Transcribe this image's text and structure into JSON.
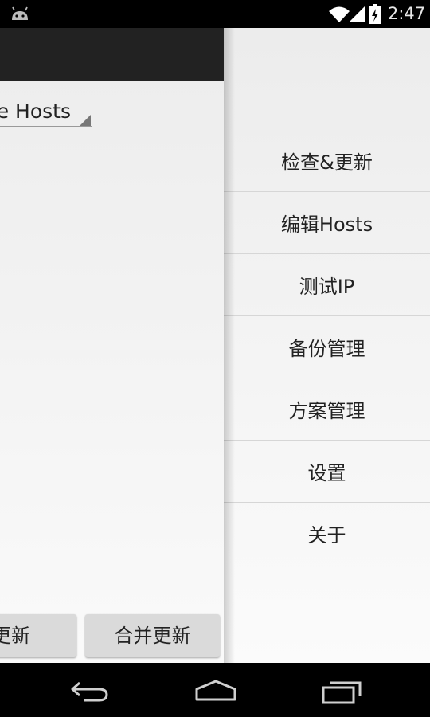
{
  "status_bar": {
    "time": "2:47"
  },
  "main": {
    "spinner_value": "e Hosts",
    "buttons": {
      "update": "更新",
      "merge_update": "合并更新"
    }
  },
  "drawer": {
    "items": [
      {
        "label": "检查&更新"
      },
      {
        "label": "编辑Hosts"
      },
      {
        "label": "测试IP"
      },
      {
        "label": "备份管理"
      },
      {
        "label": "方案管理"
      },
      {
        "label": "设置"
      },
      {
        "label": "关于"
      }
    ]
  }
}
